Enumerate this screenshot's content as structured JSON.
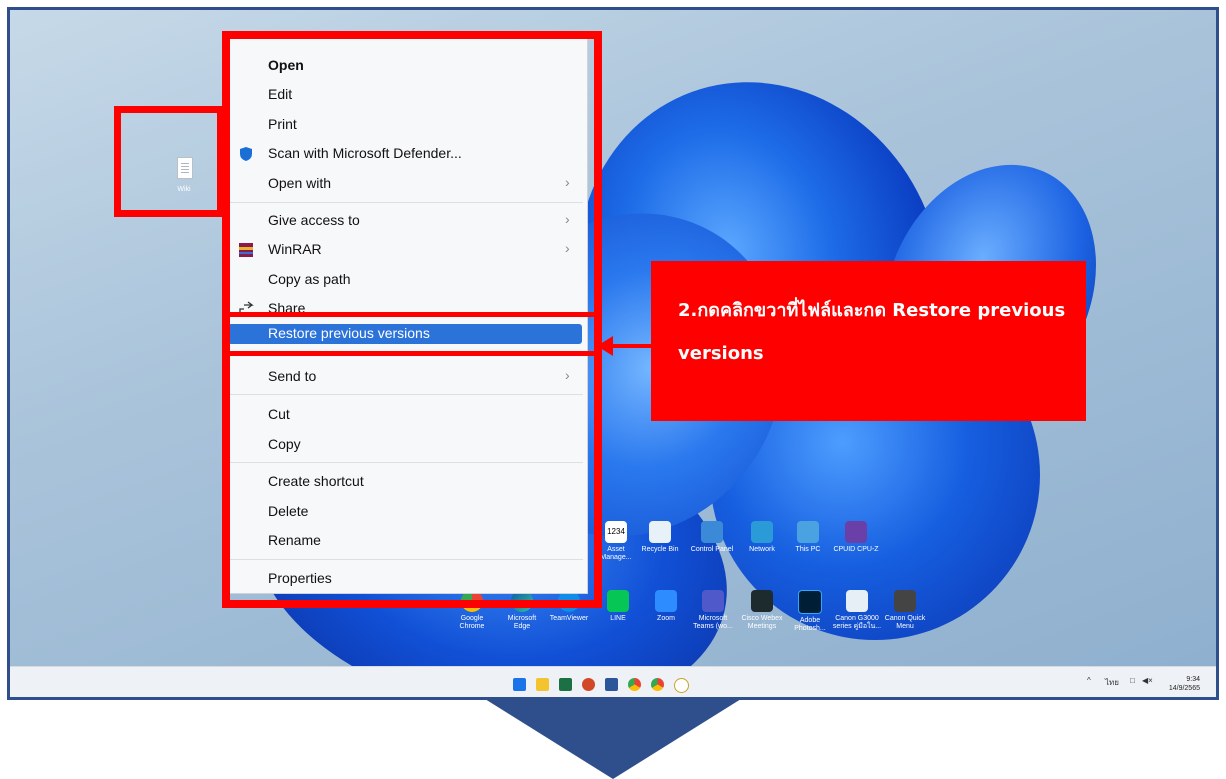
{
  "file": {
    "label": "Wiki"
  },
  "context_menu": {
    "items": [
      {
        "label": "Open",
        "bold": true
      },
      {
        "label": "Edit"
      },
      {
        "label": "Print"
      },
      {
        "label": "Scan with Microsoft Defender...",
        "icon": "shield-icon"
      },
      {
        "label": "Open with",
        "submenu": true
      },
      {
        "label": "Give access to",
        "submenu": true
      },
      {
        "label": "WinRAR",
        "icon": "winrar-icon",
        "submenu": true
      },
      {
        "label": "Copy as path"
      },
      {
        "label": "Share",
        "icon": "share-icon"
      },
      {
        "label": "Restore previous versions",
        "highlighted": true
      },
      {
        "label": "Send to",
        "submenu": true
      },
      {
        "label": "Cut"
      },
      {
        "label": "Copy"
      },
      {
        "label": "Create shortcut"
      },
      {
        "label": "Delete"
      },
      {
        "label": "Rename"
      },
      {
        "label": "Properties"
      }
    ]
  },
  "callout": {
    "text": "2.กดคลิกขวาที่ไฟล์และกด Restore previous versions"
  },
  "desktop_icons": {
    "row1": [
      "Asset Manage...",
      "Recycle Bin",
      "Control Panel",
      "Network",
      "This PC",
      "CPUID CPU-Z"
    ],
    "row2": [
      "Google Chrome",
      "Microsoft Edge",
      "TeamViewer",
      "LINE",
      "Zoom",
      "Microsoft Teams (wo...",
      "Cisco Webex Meetings",
      "Adobe Photosh...",
      "Canon G3000 series คู่มือใน...",
      "Canon Quick Menu"
    ],
    "row1_partial": "1234"
  },
  "taskbar": {
    "tray_lang": "ไทย",
    "time": "9:34",
    "date": "14/9/2565"
  },
  "colors": {
    "annotation": "#ff0000",
    "frame": "#2e4f8c",
    "highlight": "#2b73d9"
  }
}
